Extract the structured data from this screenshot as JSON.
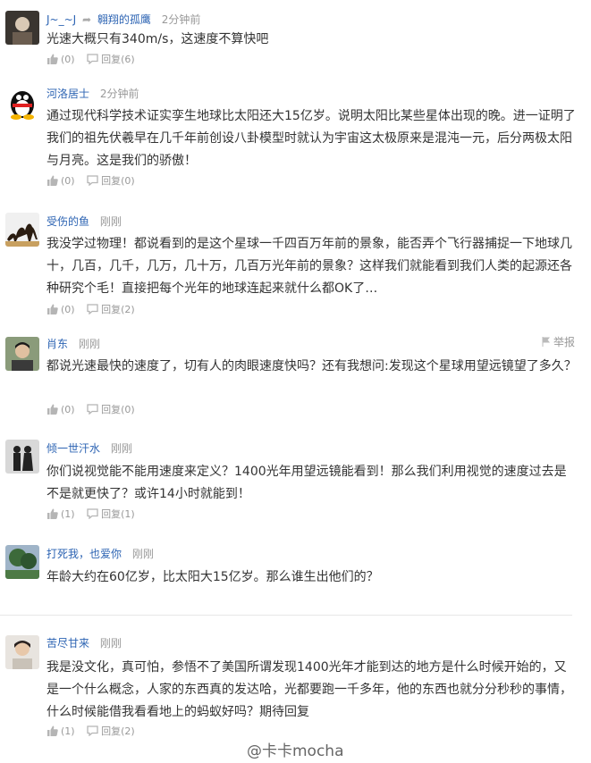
{
  "comments": [
    {
      "user": "J~_~J",
      "reply_to": "翱翔的孤鹰",
      "time": "2分钟前",
      "text": "光速大概只有340m/s，这速度不算快吧",
      "likes": "(0)",
      "reply_label": "回复",
      "reply_count": "(6)"
    },
    {
      "user": "河洛居士",
      "time": "2分钟前",
      "text": "通过现代科学技术证实孪生地球比太阳还大15亿岁。说明太阳比某些星体出现的晚。进一证明了我们的祖先伏羲早在几千年前创设八卦模型时就认为宇宙这太极原来是混沌一元，后分两极太阳与月亮。这是我们的骄傲！",
      "likes": "(0)",
      "reply_label": "回复",
      "reply_count": "(0)"
    },
    {
      "user": "受伤的鱼",
      "time": "刚刚",
      "text": "我没学过物理！都说看到的是这个星球一千四百万年前的景象，能否弄个飞行器捕捉一下地球几十，几百，几千，几万，几十万，几百万光年前的景象？这样我们就能看到我们人类的起源还各种研究个毛！直接把每个光年的地球连起来就什么都OK了…",
      "likes": "(0)",
      "reply_label": "回复",
      "reply_count": "(2)"
    },
    {
      "user": "肖东",
      "time": "刚刚",
      "report": "举报",
      "text": "都说光速最快的速度了，切有人的肉眼速度快吗？还有我想问:发现这个星球用望远镜望了多久？",
      "likes": "(0)",
      "reply_label": "回复",
      "reply_count": "(0)"
    },
    {
      "user": "倾一世汗水",
      "time": "刚刚",
      "text": "你们说视觉能不能用速度来定义？1400光年用望远镜能看到！那么我们利用视觉的速度过去是不是就更快了？或许14小时就能到！",
      "likes": "(1)",
      "reply_label": "回复",
      "reply_count": "(1)"
    },
    {
      "user": "打死我，也爱你",
      "time": "刚刚",
      "text": "年龄大约在60亿岁，比太阳大15亿岁。那么谁生出他们的？"
    },
    {
      "user": "苦尽甘来",
      "time": "刚刚",
      "text": "我是没文化，真可怕，参悟不了美国所谓发现1400光年才能到达的地方是什么时候开始的，又是一个什么概念，人家的东西真的发达哈，光都要跑一千多年，他的东西也就分分秒秒的事情，什么时候能借我看看地上的蚂蚁好吗？期待回复",
      "likes": "(1)",
      "reply_label": "回复",
      "reply_count": "(2)"
    }
  ],
  "watermark": "@卡卡mocha",
  "colors": {
    "link": "#2d64b3",
    "muted": "#999999",
    "text": "#333333"
  }
}
